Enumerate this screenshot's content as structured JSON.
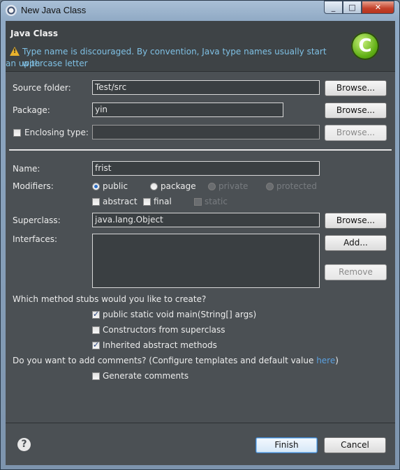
{
  "window": {
    "title": "New Java Class",
    "min": "_",
    "max": "□",
    "close": "✕"
  },
  "header": {
    "title": "Java Class",
    "warning_line1": "Type name is discouraged. By convention, Java type names usually start with",
    "warning_line2": "an uppercase letter",
    "logo_letter": "C",
    "warning_icon": "warning-icon",
    "logo_icon": "java-class-wizard-icon"
  },
  "form": {
    "source_folder": {
      "label": "Source folder:",
      "value": "Test/src",
      "button": "Browse..."
    },
    "package": {
      "label": "Package:",
      "value": "yin",
      "button": "Browse..."
    },
    "enclosing": {
      "label": "Enclosing type:",
      "value": "",
      "button": "Browse...",
      "checked": false
    },
    "name": {
      "label": "Name:",
      "value": "frist"
    },
    "modifiers": {
      "label": "Modifiers:",
      "public": "public",
      "package": "package",
      "private": "private",
      "protected": "protected",
      "abstract": "abstract",
      "final": "final",
      "static": "static",
      "selected": "public"
    },
    "superclass": {
      "label": "Superclass:",
      "value": "java.lang.Object",
      "button": "Browse..."
    },
    "interfaces": {
      "label": "Interfaces:",
      "add": "Add...",
      "remove": "Remove",
      "items": []
    },
    "stubs": {
      "question": "Which method stubs would you like to create?",
      "main": "public static void main(String[] args)",
      "constructors": "Constructors from superclass",
      "inherited": "Inherited abstract methods",
      "main_checked": true,
      "constructors_checked": false,
      "inherited_checked": true
    },
    "comments": {
      "question_prefix": "Do you want to add comments? (Configure templates and default value ",
      "link": "here",
      "question_suffix": ")",
      "generate": "Generate comments",
      "generate_checked": false
    }
  },
  "footer": {
    "help": "?",
    "finish": "Finish",
    "cancel": "Cancel"
  }
}
